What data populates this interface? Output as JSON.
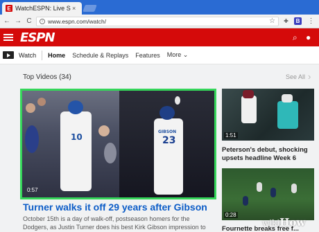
{
  "browser": {
    "tab_title": "WatchESPN: Live Sports",
    "tab_close": "×",
    "favicon_letter": "E",
    "url": "www.espn.com/watch/",
    "nav": [
      "←",
      "→",
      "C"
    ]
  },
  "espn": {
    "logo": "ESPN"
  },
  "subnav": {
    "watch_label": "Watch",
    "items": [
      "Home",
      "Schedule & Replays",
      "Features",
      "More ⌄"
    ]
  },
  "section": {
    "title": "Top Videos (34)",
    "see_all": "See All"
  },
  "hero": {
    "duration": "0:57",
    "title": "Turner walks it off 29 years after Gibson",
    "description": "October 15th is a day of walk-off, postseason homers for the Dodgers, as Justin Turner does his best Kirk Gibson impression to knock off the",
    "jersey_left": "10",
    "jersey_right": "23",
    "jersey_name": "GIBSON"
  },
  "side_videos": [
    {
      "duration": "1:51",
      "title": "Peterson's debut, shocking upsets headline Week 6"
    },
    {
      "duration": "0:28",
      "title": "Fournette breaks free f..."
    }
  ],
  "watermark": {
    "prefix": "wiki",
    "suffix": "How"
  },
  "colors": {
    "espn_red": "#d50a0a",
    "highlight_green": "#35d65a",
    "link_blue": "#0b5cc7"
  }
}
